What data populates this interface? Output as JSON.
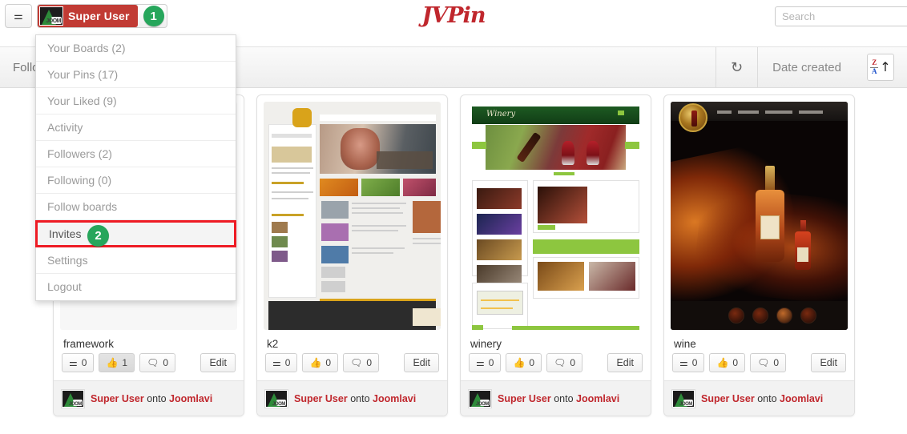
{
  "header": {
    "pin_button_icon": "pin-icon",
    "user_name": "Super User",
    "user_badge": "1",
    "logo_text": "JVPin",
    "search_placeholder": "Search",
    "search_value": ""
  },
  "toolbar": {
    "left_label": "Follo",
    "refresh_icon": "refresh-icon",
    "sort_field": "Date created",
    "sort_direction_icon": "sort-za-ascending-icon",
    "sort_z": "Z",
    "sort_a": "A",
    "sort_arrow": "↑"
  },
  "dropdown": {
    "items": [
      {
        "label": "Your Boards (2)",
        "badge": null,
        "highlighted": false
      },
      {
        "label": "Your Pins (17)",
        "badge": null,
        "highlighted": false
      },
      {
        "label": "Your Liked (9)",
        "badge": null,
        "highlighted": false
      },
      {
        "label": "Activity",
        "badge": null,
        "highlighted": false
      },
      {
        "label": "Followers (2)",
        "badge": null,
        "highlighted": false
      },
      {
        "label": "Following (0)",
        "badge": null,
        "highlighted": false
      },
      {
        "label": "Follow boards",
        "badge": null,
        "highlighted": false
      },
      {
        "label": "Invites",
        "badge": "2",
        "highlighted": true
      },
      {
        "label": "Settings",
        "badge": null,
        "highlighted": false
      },
      {
        "label": "Logout",
        "badge": null,
        "highlighted": false
      }
    ]
  },
  "cards": [
    {
      "title": "framework",
      "thumb_kind": "framework-website-screenshot",
      "pin_count": "0",
      "like_count": "1",
      "like_active": true,
      "comment_count": "0",
      "edit_label": "Edit",
      "author": "Super User",
      "onto_word": "onto",
      "board": "Joomlavi"
    },
    {
      "title": "k2",
      "thumb_kind": "k2-website-screenshot",
      "pin_count": "0",
      "like_count": "0",
      "like_active": false,
      "comment_count": "0",
      "edit_label": "Edit",
      "author": "Super User",
      "onto_word": "onto",
      "board": "Joomlavi"
    },
    {
      "title": "winery",
      "thumb_kind": "winery-website-screenshot",
      "pin_count": "0",
      "like_count": "0",
      "like_active": false,
      "comment_count": "0",
      "edit_label": "Edit",
      "author": "Super User",
      "onto_word": "onto",
      "board": "Joomlavi"
    },
    {
      "title": "wine",
      "thumb_kind": "wine-website-screenshot",
      "pin_count": "0",
      "like_count": "0",
      "like_active": false,
      "comment_count": "0",
      "edit_label": "Edit",
      "author": "Super User",
      "onto_word": "onto",
      "board": "Joomlavi"
    }
  ],
  "icons": {
    "pin": "⍠",
    "thumb_up": "✋",
    "comment": "▬",
    "refresh": "↻"
  },
  "colors": {
    "brand_red": "#c0272d",
    "user_button_red": "#c13b34",
    "badge_green": "#26a65b",
    "highlight_red": "#ee1b24",
    "toolbar_bg": "#f3f3f3",
    "card_footer_bg": "#f2f2f2"
  },
  "avatar_label": "JOOM"
}
